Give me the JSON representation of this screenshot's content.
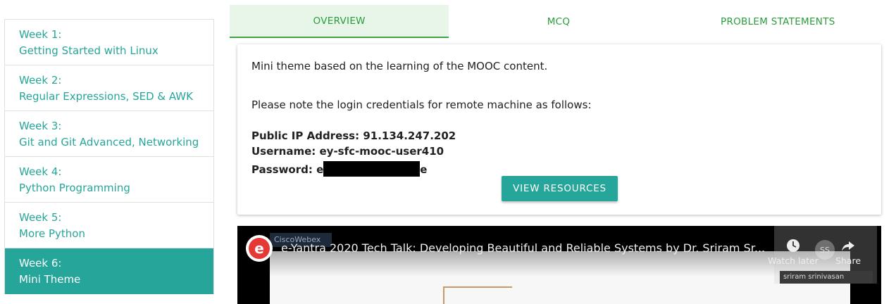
{
  "sidebar": {
    "items": [
      {
        "week": "Week 1:",
        "title": "Getting Started with Linux"
      },
      {
        "week": "Week 2:",
        "title": "Regular Expressions, SED & AWK"
      },
      {
        "week": "Week 3:",
        "title": "Git and Git Advanced, Networking"
      },
      {
        "week": "Week 4:",
        "title": "Python Programming"
      },
      {
        "week": "Week 5:",
        "title": "More Python"
      },
      {
        "week": "Week 6:",
        "title": "Mini Theme"
      }
    ],
    "active_index": 5
  },
  "tabs": {
    "overview": "OVERVIEW",
    "mcq": "MCQ",
    "problems": "PROBLEM STATEMENTS",
    "active": "OVERVIEW"
  },
  "overview": {
    "intro": "Mini theme based on the learning of the MOOC content.",
    "note": "Please note the login credentials for remote machine as follows:",
    "ip_label": "Public IP Address: 91.134.247.202",
    "username_label": "Username: ey-sfc-mooc-user410",
    "password_prefix": "Password: e",
    "password_suffix": "e",
    "button": "VIEW RESOURCES"
  },
  "video": {
    "title": "e-Yantra 2020 Tech Talk: Developing Beautiful and Reliable Systems by Dr. Sriram Sr...",
    "channel_badge": "CiscoWebex",
    "watch_later": "Watch later",
    "share": "Share",
    "avatar_initials": "SS",
    "uploader": "sriram srinivasan"
  },
  "colors": {
    "accent": "#26a69a",
    "tab_text": "#2a9d3a",
    "tab_active_bg": "#e8f5e9"
  }
}
